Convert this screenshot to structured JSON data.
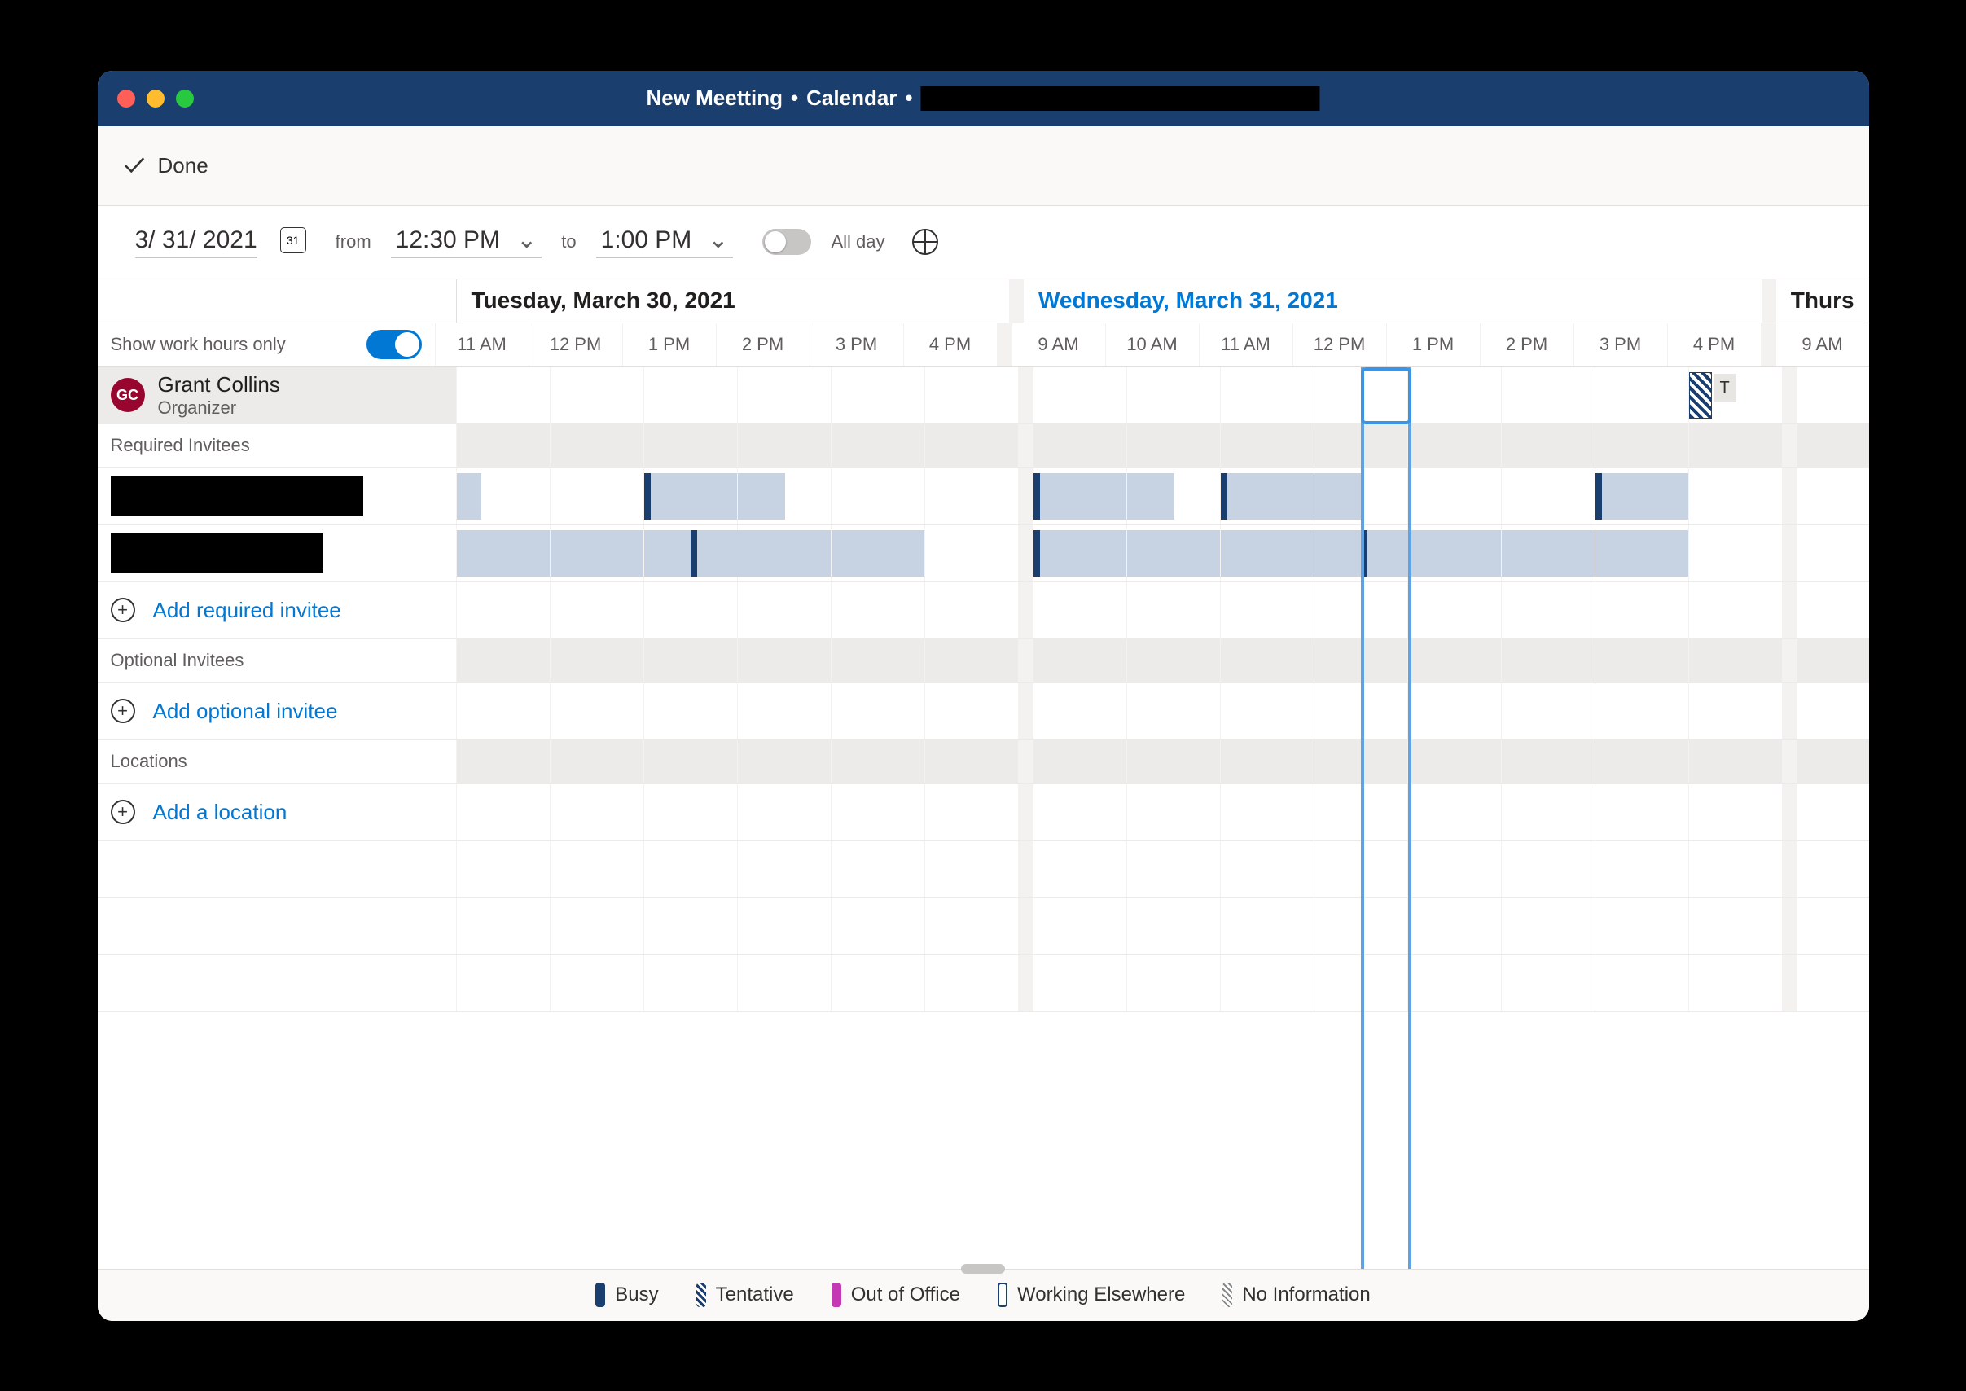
{
  "title": {
    "meeting": "New Meetting",
    "section": "Calendar"
  },
  "toolbar": {
    "done": "Done"
  },
  "datetime": {
    "date": "3/ 31/ 2021",
    "cal_day": "31",
    "from_label": "from",
    "from_time": "12:30 PM",
    "to_label": "to",
    "to_time": "1:00 PM",
    "all_day": "All day"
  },
  "days": {
    "tue": "Tuesday, March 30, 2021",
    "wed": "Wednesday, March 31, 2021",
    "thu": "Thursday"
  },
  "hours_tue": [
    "11 AM",
    "12 PM",
    "1 PM",
    "2 PM",
    "3 PM",
    "4 PM"
  ],
  "hours_wed": [
    "9 AM",
    "10 AM",
    "11 AM",
    "12 PM",
    "1 PM",
    "2 PM",
    "3 PM",
    "4 PM"
  ],
  "hours_thu": [
    "9 AM"
  ],
  "work_hours_label": "Show work hours only",
  "organizer": {
    "initials": "GC",
    "name": "Grant Collins",
    "role": "Organizer",
    "tentative_label": "T"
  },
  "sections": {
    "required": "Required Invitees",
    "optional": "Optional Invitees",
    "locations": "Locations"
  },
  "actions": {
    "add_required": "Add required invitee",
    "add_optional": "Add optional invitee",
    "add_location": "Add a location"
  },
  "legend": {
    "busy": "Busy",
    "tentative": "Tentative",
    "ooo": "Out of Office",
    "we": "Working Elsewhere",
    "noinfo": "No Information"
  }
}
